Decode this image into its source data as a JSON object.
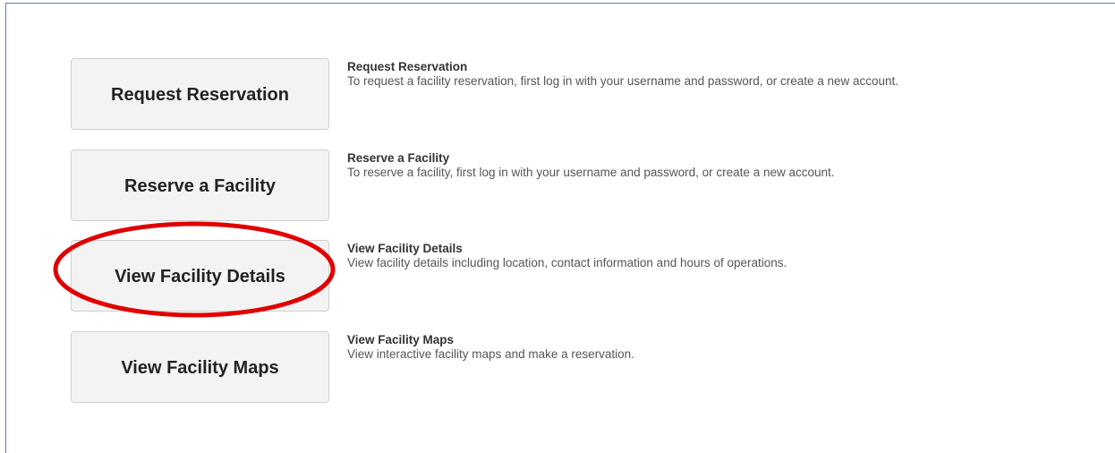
{
  "actions": [
    {
      "button_label": "Request Reservation",
      "title": "Request Reservation",
      "description": "To request a facility reservation, first log in with your username and password, or create a new account."
    },
    {
      "button_label": "Reserve a Facility",
      "title": "Reserve a Facility",
      "description": "To reserve a facility, first log in with your username and password, or create a new account."
    },
    {
      "button_label": "View Facility Details",
      "title": "View Facility Details",
      "description": "View facility details including location, contact information and hours of operations."
    },
    {
      "button_label": "View Facility Maps",
      "title": "View Facility Maps",
      "description": "View interactive facility maps and make a reservation."
    }
  ],
  "highlight": {
    "target": "View Facility Details",
    "color": "#e00000"
  },
  "colors": {
    "frame_border": "#5b7fb3",
    "button_bg": "#f3f3f3",
    "button_border": "#cfcfcf"
  }
}
